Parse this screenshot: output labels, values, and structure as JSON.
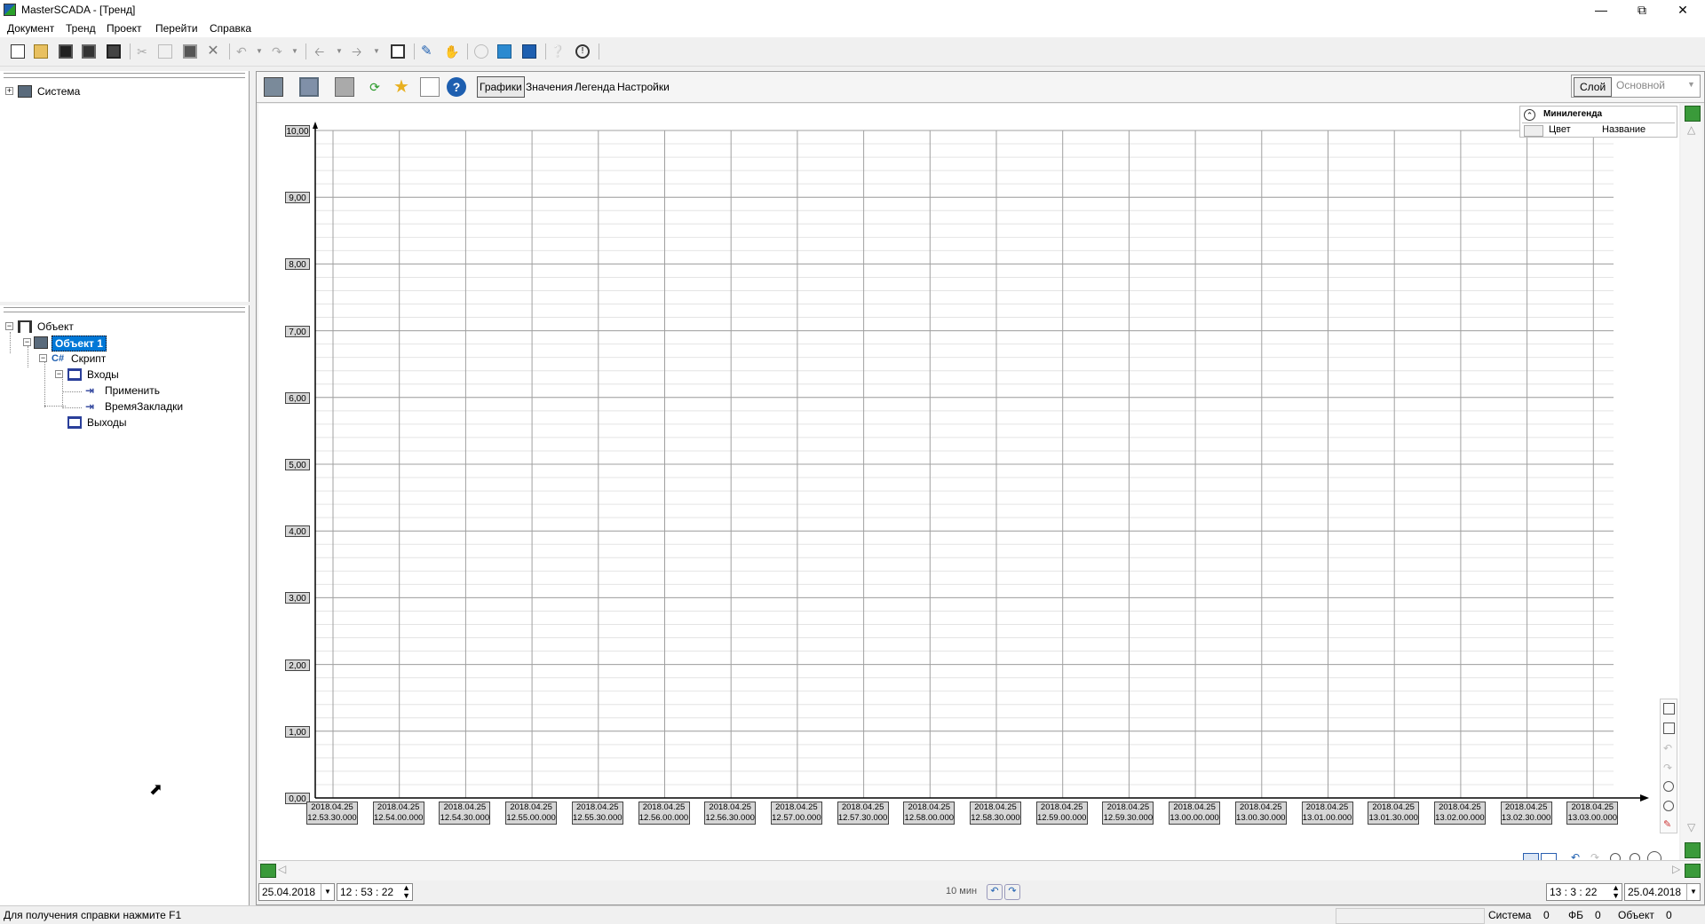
{
  "window": {
    "title": "MasterSCADA - [Тренд]"
  },
  "menu": [
    "Документ",
    "Тренд",
    "Проект",
    "Перейти",
    "Справка"
  ],
  "tree_top": {
    "items": [
      {
        "label": "Система"
      }
    ]
  },
  "tree_bottom": {
    "items": [
      {
        "label": "Объект"
      },
      {
        "label": "Объект 1"
      },
      {
        "label": "Скрипт"
      },
      {
        "label": "Входы"
      },
      {
        "label": "Применить"
      },
      {
        "label": "ВремяЗакладки"
      },
      {
        "label": "Выходы"
      }
    ]
  },
  "trend": {
    "tabs": [
      "Графики",
      "Значения",
      "Легенда",
      "Настройки"
    ],
    "active_tab": "Графики",
    "layer_label": "Слой",
    "layer_value": "Основной",
    "minilegend": {
      "title": "Минилегенда",
      "col_color": "Цвет",
      "col_name": "Название"
    }
  },
  "chart_data": {
    "type": "line",
    "series": [],
    "ylim": [
      0,
      10
    ],
    "y_ticks": [
      "10,00",
      "9,00",
      "8,00",
      "7,00",
      "6,00",
      "5,00",
      "4,00",
      "3,00",
      "2,00",
      "1,00",
      "0,00"
    ],
    "x_ticks": [
      [
        "2018.04.25",
        "12.53.30.000"
      ],
      [
        "2018.04.25",
        "12.54.00.000"
      ],
      [
        "2018.04.25",
        "12.54.30.000"
      ],
      [
        "2018.04.25",
        "12.55.00.000"
      ],
      [
        "2018.04.25",
        "12.55.30.000"
      ],
      [
        "2018.04.25",
        "12.56.00.000"
      ],
      [
        "2018.04.25",
        "12.56.30.000"
      ],
      [
        "2018.04.25",
        "12.57.00.000"
      ],
      [
        "2018.04.25",
        "12.57.30.000"
      ],
      [
        "2018.04.25",
        "12.58.00.000"
      ],
      [
        "2018.04.25",
        "12.58.30.000"
      ],
      [
        "2018.04.25",
        "12.59.00.000"
      ],
      [
        "2018.04.25",
        "12.59.30.000"
      ],
      [
        "2018.04.25",
        "13.00.00.000"
      ],
      [
        "2018.04.25",
        "13.00.30.000"
      ],
      [
        "2018.04.25",
        "13.01.00.000"
      ],
      [
        "2018.04.25",
        "13.01.30.000"
      ],
      [
        "2018.04.25",
        "13.02.00.000"
      ],
      [
        "2018.04.25",
        "13.02.30.000"
      ],
      [
        "2018.04.25",
        "13.03.00.000"
      ]
    ],
    "grid": true
  },
  "time_controls": {
    "start_date": "25.04.2018",
    "start_time": "12 : 53 : 22",
    "span": "10 мин",
    "end_time": "13 : 3 : 22",
    "end_date": "25.04.2018"
  },
  "status": {
    "help": "Для получения справки нажмите F1",
    "system_label": "Система",
    "system_value": "0",
    "fb_label": "ФБ",
    "fb_value": "0",
    "object_label": "Объект",
    "object_value": "0"
  },
  "colors": {
    "selection": "#0078d7",
    "grid": "#a0a0a0",
    "grid_minor": "#e4e4e4"
  }
}
